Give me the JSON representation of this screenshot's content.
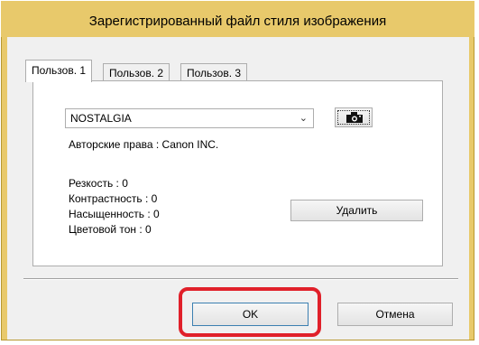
{
  "window": {
    "title": "Зарегистрированный файл стиля изображения"
  },
  "tabs": [
    {
      "label": "Пользов. 1",
      "active": true
    },
    {
      "label": "Пользов. 2",
      "active": false
    },
    {
      "label": "Пользов. 3",
      "active": false
    }
  ],
  "style_select": {
    "value": "NOSTALGIA",
    "arrow_icon": "chevron-down-icon"
  },
  "open_button": {
    "icon": "camera-icon"
  },
  "info": {
    "copyright": "Авторские права : Canon INC.",
    "sharpness": "Резкость : 0",
    "contrast": "Контрастность : 0",
    "saturation": "Насыщенность : 0",
    "color_tone": "Цветовой тон : 0"
  },
  "delete_button": {
    "label": "Удалить"
  },
  "footer": {
    "ok_label": "OK",
    "cancel_label": "Отмена"
  },
  "colors": {
    "title_bar": "#e8c96b",
    "highlight": "#e0202a"
  }
}
